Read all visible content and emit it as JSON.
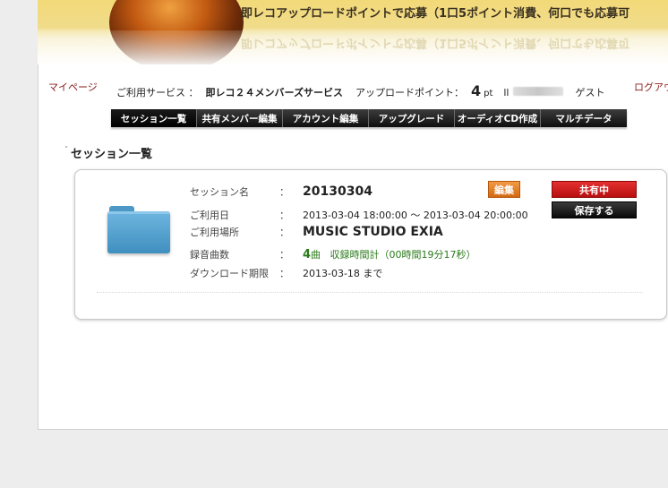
{
  "banner": {
    "title": "即レコアップロードポイントで応募（1口5ポイント消費、何口でも応募可"
  },
  "header": {
    "mypage": "マイページ",
    "logout": "ログアウ",
    "service_label": "ご利用サービス ：",
    "service_name": "即レコ２４メンバーズサービス",
    "upload_label": "アップロードポイント：",
    "points": "4",
    "points_unit": "pt",
    "user_prefix": "ll",
    "guest": "ゲスト"
  },
  "nav": {
    "items": [
      "セッション一覧",
      "共有メンバー編集",
      "アカウント編集",
      "アップグレード",
      "オーディオCD作成",
      "マルチデータ"
    ]
  },
  "section": {
    "title": "セッション一覧"
  },
  "session": {
    "labels": {
      "name": "セッション名",
      "datetime": "ご利用日",
      "place": "ご利用場所",
      "tracks": "録音曲数",
      "deadline": "ダウンロード期限"
    },
    "colon": "：",
    "name": "20130304",
    "datetime": "2013-03-04 18:00:00 〜 2013-03-04 20:00:00",
    "place": "MUSIC STUDIO EXIA",
    "track_count": "4",
    "track_unit": "曲",
    "track_total": "収録時間計（00時間19分17秒）",
    "deadline": "2013-03-18 まで",
    "edit_label": "編集",
    "share_label": "共有中",
    "save_label": "保存する"
  },
  "colors": {
    "share": "#d41c1c",
    "edit": "#e27a22",
    "nav": "#1a1a1a",
    "link": "#8b1a1a",
    "track_count": "#2a7a1a"
  }
}
